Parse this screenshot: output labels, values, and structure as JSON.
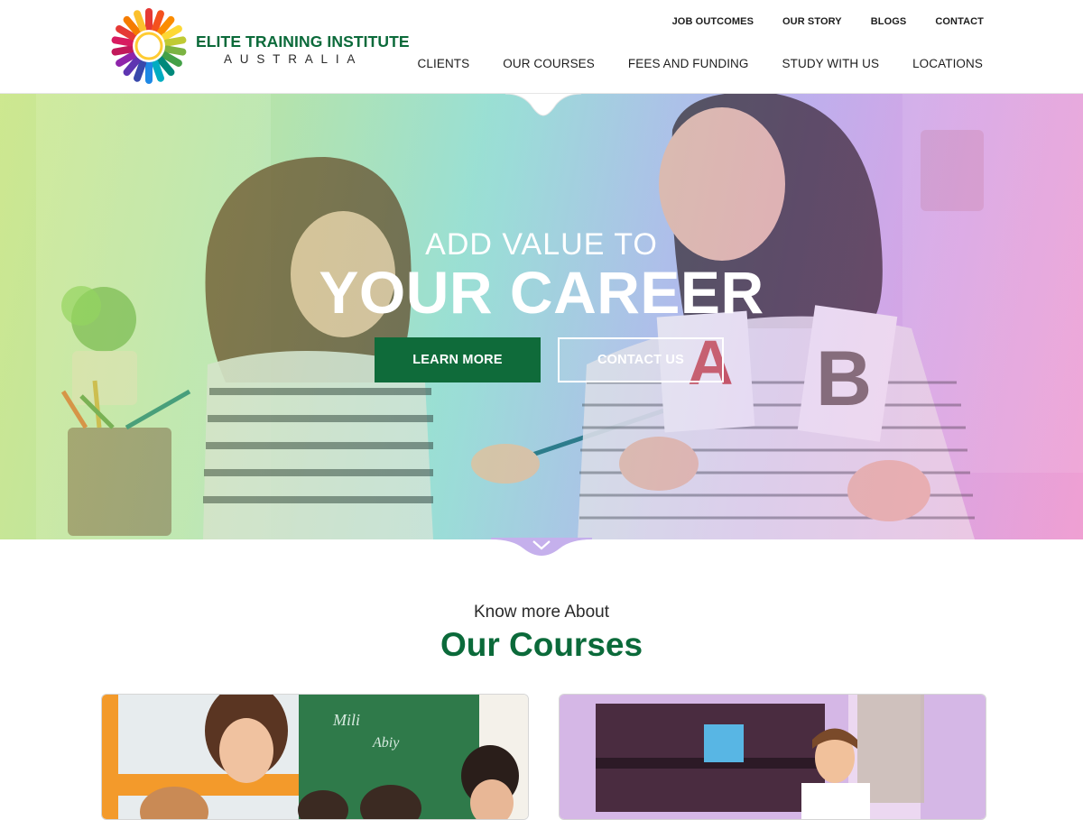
{
  "brand": {
    "title": "ELITE TRAINING INSTITUTE",
    "subtitle": "AUSTRALIA",
    "logo_icon": "colorful-hands-wheel-logo",
    "primary_color": "#0b6a3a"
  },
  "nav": {
    "utility": [
      {
        "label": "JOB OUTCOMES"
      },
      {
        "label": "OUR STORY"
      },
      {
        "label": "BLOGS"
      },
      {
        "label": "CONTACT"
      }
    ],
    "main": [
      {
        "label": "CLIENTS"
      },
      {
        "label": "OUR COURSES"
      },
      {
        "label": "FEES AND FUNDING"
      },
      {
        "label": "STUDY WITH US"
      },
      {
        "label": "LOCATIONS"
      }
    ]
  },
  "hero": {
    "kicker": "ADD VALUE TO",
    "title": "YOUR CAREER",
    "learn_more_label": "LEARN MORE",
    "contact_label": "CONTACT US",
    "card_a": "A",
    "card_b": "B",
    "scroll_icon": "chevron-down-icon"
  },
  "courses": {
    "kicker": "Know more About",
    "title": "Our Courses",
    "board_text_1": "Mili",
    "board_text_2": "Abiy"
  }
}
